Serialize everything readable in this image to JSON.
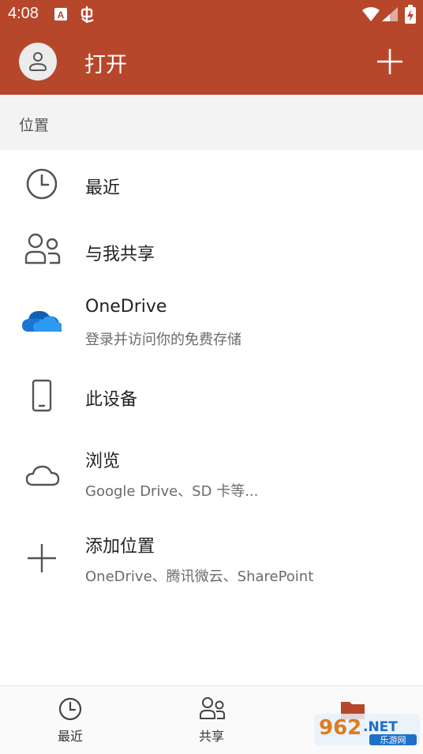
{
  "status_bar": {
    "time": "4:08",
    "icons": [
      "a-notification-icon",
      "bug-icon",
      "wifi-icon",
      "signal-icon",
      "battery-charging-icon"
    ]
  },
  "app_bar": {
    "title": "打开",
    "color": "#b7472a",
    "avatar_icon": "person-icon",
    "add_icon": "plus-icon"
  },
  "section": {
    "header": "位置"
  },
  "locations": [
    {
      "icon": "clock-icon",
      "label": "最近",
      "sub": ""
    },
    {
      "icon": "people-icon",
      "label": "与我共享",
      "sub": ""
    },
    {
      "icon": "onedrive-cloud-icon",
      "label": "OneDrive",
      "sub": "登录并访问你的免费存储"
    },
    {
      "icon": "phone-icon",
      "label": "此设备",
      "sub": ""
    },
    {
      "icon": "cloud-outline-icon",
      "label": "浏览",
      "sub": "Google Drive、SD 卡等..."
    },
    {
      "icon": "plus-icon",
      "label": "添加位置",
      "sub": "OneDrive、腾讯微云、SharePoint"
    }
  ],
  "bottom_nav": [
    {
      "icon": "clock-icon",
      "label": "最近"
    },
    {
      "icon": "people-icon",
      "label": "共享"
    },
    {
      "icon": "folder-icon",
      "label": ""
    }
  ],
  "watermark": {
    "brand": "962.NET",
    "tagline": "乐游网"
  }
}
